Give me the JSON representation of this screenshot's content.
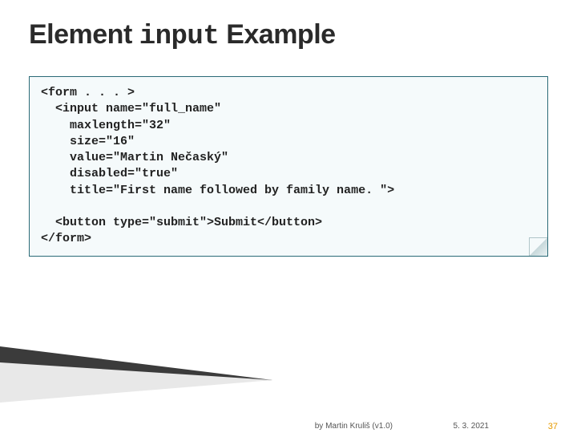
{
  "title": {
    "pre": "Element ",
    "code": "input",
    "post": " Example"
  },
  "code": {
    "l1": "<form . . . >",
    "l2": "  <input name=\"full_name\"",
    "l3": "    maxlength=\"32\"",
    "l4": "    size=\"16\"",
    "l5": "    value=\"Martin Nečaský\"",
    "l6": "    disabled=\"true\"",
    "l7": "    title=\"First name followed by family name. \">",
    "l8": " ",
    "l9": "  <button type=\"submit\">Submit</button>",
    "l10": "</form>"
  },
  "footer": {
    "author": "by Martin Kruliš (v1.0)",
    "date": "5. 3. 2021",
    "page": "37"
  }
}
